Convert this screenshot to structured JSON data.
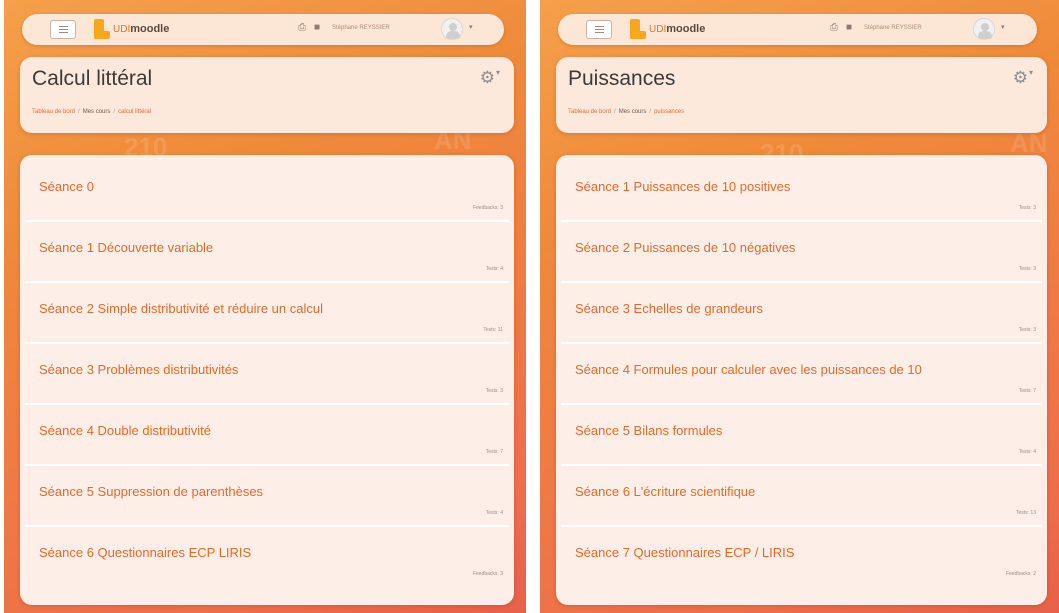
{
  "app": {
    "logo_prefix": "UDI",
    "logo_name": "moodle"
  },
  "panels": [
    {
      "navbar": {
        "user_name": "Stéphane REYSSIER"
      },
      "header": {
        "title": "Calcul littéral",
        "breadcrumb": [
          "Tableau de bord",
          "Mes cours",
          "calcul littéral"
        ]
      },
      "sections": [
        {
          "name": "Séance 0",
          "meta": "Feedbacks: 3"
        },
        {
          "name": "Séance 1 Découverte variable",
          "meta": "Tests: 4"
        },
        {
          "name": "Séance 2 Simple distributivité et réduire un calcul",
          "meta": "Tests: 11"
        },
        {
          "name": "Séance 3 Problèmes distributivités",
          "meta": "Tests: 3"
        },
        {
          "name": "Séance 4 Double distributivité",
          "meta": "Tests: 7"
        },
        {
          "name": "Séance 5 Suppression de parenthèses",
          "meta": "Tests: 4"
        },
        {
          "name": "Séance 6 Questionnaires ECP LIRIS",
          "meta": "Feedbacks: 3"
        }
      ]
    },
    {
      "navbar": {
        "user_name": "Stéphane REYSSIER"
      },
      "header": {
        "title": "Puissances",
        "breadcrumb": [
          "Tableau de bord",
          "Mes cours",
          "puissances"
        ]
      },
      "sections": [
        {
          "name": "Séance 1 Puissances de 10 positives",
          "meta": "Tests: 3"
        },
        {
          "name": "Séance 2 Puissances de 10 négatives",
          "meta": "Tests: 3"
        },
        {
          "name": "Séance 3 Echelles de grandeurs",
          "meta": "Tests: 3"
        },
        {
          "name": "Séance 4 Formules pour calculer avec les puissances de 10",
          "meta": "Tests: 7"
        },
        {
          "name": "Séance 5 Bilans formules",
          "meta": "Tests: 4"
        },
        {
          "name": "Séance 6 L'écriture scientifique",
          "meta": "Tests: 13"
        },
        {
          "name": "Séance 7 Questionnaires ECP / LIRIS",
          "meta": "Feedbacks: 2"
        }
      ]
    }
  ],
  "icons": {
    "menu": "hamburger-icon",
    "print": "printer-icon",
    "messages": "message-icon",
    "settings": "gear-icon",
    "dropdown": "chevron-down-icon",
    "avatar": "user-avatar-icon"
  },
  "colors": {
    "accent": "#e36b28",
    "background_gradient_start": "#f5a04a",
    "background_gradient_end": "#e8604a",
    "card": "#fdeee8",
    "logo": "#f7a71b"
  }
}
